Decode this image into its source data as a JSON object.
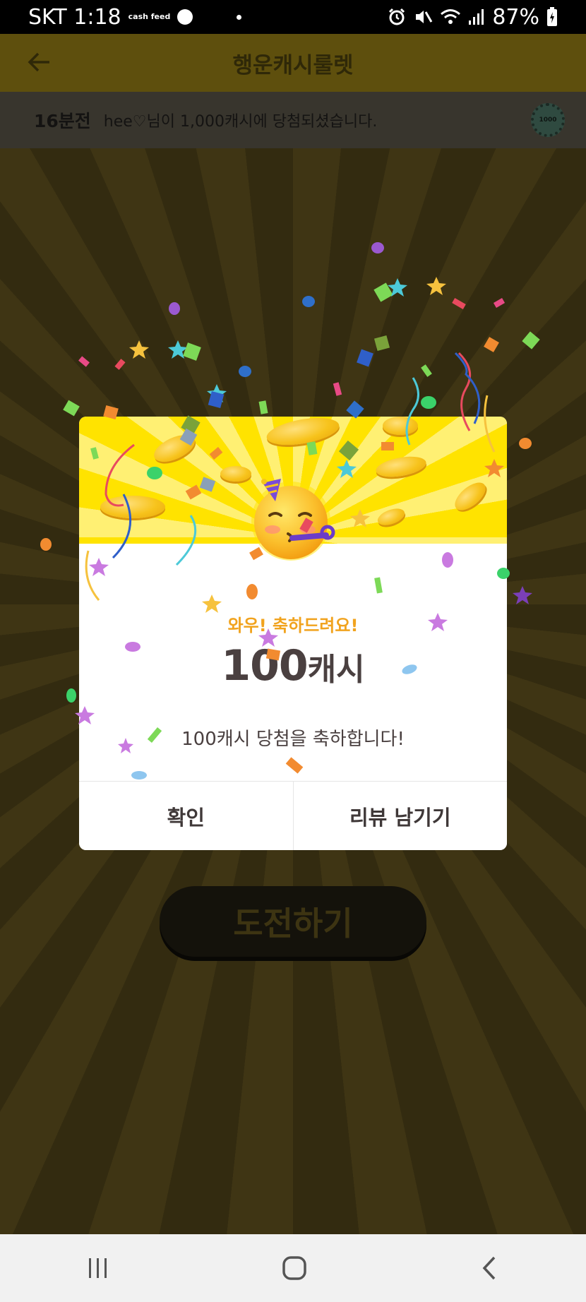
{
  "status_bar": {
    "carrier_time": "SKT 1:18",
    "cashfeed_label": "cash feed",
    "battery": "87%",
    "icons": [
      "alarm-icon",
      "mute-icon",
      "wifi-icon",
      "signal-icon",
      "battery-icon"
    ]
  },
  "header": {
    "title": "행운캐시룰렛",
    "back_icon": "back-arrow-icon"
  },
  "ticker": {
    "time": "16분전",
    "message": "hee♡님이 1,000캐시에 당첨되셨습니다.",
    "coin_label": "1000"
  },
  "modal": {
    "congrats": "와우! 축하드려요!",
    "prize_amount": "100",
    "prize_unit": "캐시",
    "message": "100캐시 당첨을 축하합니다!",
    "confirm_label": "확인",
    "review_label": "리뷰 남기기",
    "emoji": "partying-face-emoji"
  },
  "main": {
    "challenge_label": "도전하기"
  },
  "nav": {
    "icons": [
      "recent-apps-icon",
      "home-icon",
      "back-icon"
    ]
  },
  "colors": {
    "modal_top": "#ffe300",
    "congrats_text": "#f1a31e",
    "dim_overlay": "#3a3212"
  }
}
